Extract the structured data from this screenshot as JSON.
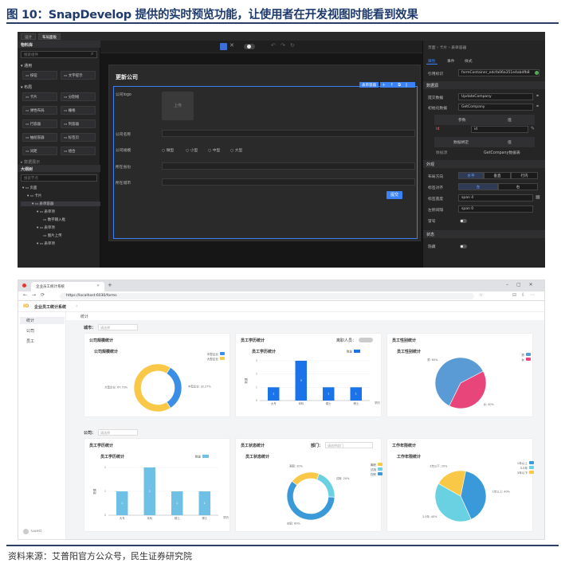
{
  "figure": {
    "title": "图 10：SnapDevelop 提供的实时预览功能，让使用者在开发视图时能看到效果",
    "source": "资料来源：艾普阳官方公众号，民生证券研究院"
  },
  "editor": {
    "tabs": [
      "设计",
      "布局面板"
    ],
    "left": {
      "components_header": "物料库",
      "search_placeholder": "搜索组件",
      "categories": [
        "通用",
        "布局",
        "数据展示"
      ],
      "components": [
        "按钮",
        "文字提示",
        "卡片",
        "分割线",
        "弹性布局",
        "栅格",
        "行容器",
        "列容器",
        "抽屉容器",
        "标签页",
        "间距",
        "组合"
      ],
      "tree_header": "大纲树",
      "tree_search_placeholder": "搜索节点",
      "tree": [
        "页面",
        "卡片",
        "表单容器",
        "表单项",
        "数字输入框",
        "表单项",
        "图片上传",
        "表单项"
      ]
    },
    "canvas": {
      "card_title": "更新公司",
      "selected_tag": "表单容器",
      "upload_label": "上传",
      "labels": [
        "公司logo",
        "公司名称",
        "公司规模",
        "所在省份",
        "所在城市"
      ],
      "size_options": [
        "微型",
        "小型",
        "中型",
        "大型"
      ],
      "submit_label": "提交"
    },
    "right": {
      "breadcrumb": [
        "页面",
        "卡片",
        "表单容器"
      ],
      "tabs": [
        "属性",
        "事件",
        "样式"
      ],
      "ref_label": "引用标识",
      "ref_value": "formContainer_edcfa06a351e4abdfb8",
      "data_section": "数据源",
      "submit_data_label": "提交数据",
      "submit_data_value": "UpdateCompany",
      "init_data_label": "初始化数据",
      "init_data_value": "GetCompany",
      "param_header": "参数",
      "value_header": "值",
      "param_id": "id",
      "param_id_value": "id",
      "binding_header": "数据绑定",
      "binding_value_header": "值",
      "binding_key": "数据源",
      "binding_value": "GetCompany数据表",
      "appearance_section": "外观",
      "layout_label": "布局方向",
      "layout_options": [
        "水平",
        "垂直",
        "行内"
      ],
      "align_label": "标签对齐",
      "align_options": [
        "左",
        "右"
      ],
      "label_width_label": "标签宽度",
      "label_width_value": "span 4",
      "left_spacing_label": "左侧间隔",
      "left_spacing_value": "span 0",
      "colon_label": "冒号",
      "state_section": "状态",
      "hidden_label": "隐藏"
    }
  },
  "browser": {
    "tab_title": "企业员工统计系统",
    "url": "https://localhost:6030/forms",
    "app_title": "企业员工统计系统",
    "nav": [
      "统计",
      "公司",
      "员工"
    ],
    "breadcrumb": "统计",
    "footer_user": "Guest",
    "city_filter": {
      "label": "城市：",
      "placeholder": "请选择"
    },
    "company_filter": {
      "label": "公司：",
      "placeholder": "请选择"
    },
    "dept_filter": {
      "label": "部门：",
      "placeholder": "请选择部门"
    },
    "resigned_label": "离职人员：",
    "cards": {
      "company_size": "公司规模统计",
      "edu_top": "员工学历统计",
      "gender": "员工性别统计",
      "edu_bottom": "员工学历统计",
      "status": "员工状态统计",
      "tenure": "工作年限统计"
    }
  },
  "chart_data": [
    {
      "type": "pie",
      "title": "公司规模统计",
      "labels": [
        "中型企业",
        "大型企业"
      ],
      "values": [
        32.27,
        67.73
      ],
      "data_labels": [
        "中型企业: 32.27%",
        "大型企业: 67.73%"
      ],
      "colors": [
        "#3a8ee6",
        "#f9c846"
      ],
      "legend": "top-right"
    },
    {
      "type": "bar",
      "title": "员工学历统计",
      "categories": [
        "大专",
        "本科",
        "硕士",
        "博士"
      ],
      "values": [
        1,
        3,
        1,
        1
      ],
      "ylabel": "数量",
      "xlabel": "学历",
      "series_name": "数量",
      "color": "#1a73e8",
      "legend": "top-right"
    },
    {
      "type": "pie",
      "title": "员工性别统计",
      "labels": [
        "男",
        "女"
      ],
      "values": [
        60,
        40
      ],
      "data_labels": [
        "男: 60%",
        "女: 40%"
      ],
      "colors": [
        "#5b9bd5",
        "#e8457a"
      ],
      "legend": "top-right"
    },
    {
      "type": "bar",
      "title": "员工学历统计",
      "categories": [
        "大专",
        "本科",
        "硕士",
        "博士"
      ],
      "values": [
        1,
        2,
        1,
        1
      ],
      "ylabel": "数量",
      "xlabel": "学历",
      "series_name": "数量",
      "color": "#6ec1e4",
      "legend": "top-right"
    },
    {
      "type": "pie",
      "title": "员工状态统计",
      "labels": [
        "离职",
        "试用",
        "在职"
      ],
      "values": [
        20,
        20,
        60
      ],
      "data_labels": [
        "离职: 20%",
        "试用: 20%",
        "在职: 60%"
      ],
      "colors": [
        "#f9c846",
        "#6ad1e3",
        "#3a9ad9"
      ],
      "legend": "top-right"
    },
    {
      "type": "pie",
      "title": "工作年限统计",
      "labels": [
        "1年以上",
        "3-5年",
        "3年以下"
      ],
      "values": [
        40,
        40,
        20
      ],
      "data_labels": [
        "1年以上: 40%",
        "3-5年: 40%",
        "3年以下: 20%"
      ],
      "colors": [
        "#3a9ad9",
        "#6ad1e3",
        "#f9c846"
      ],
      "legend": "top-right"
    }
  ]
}
